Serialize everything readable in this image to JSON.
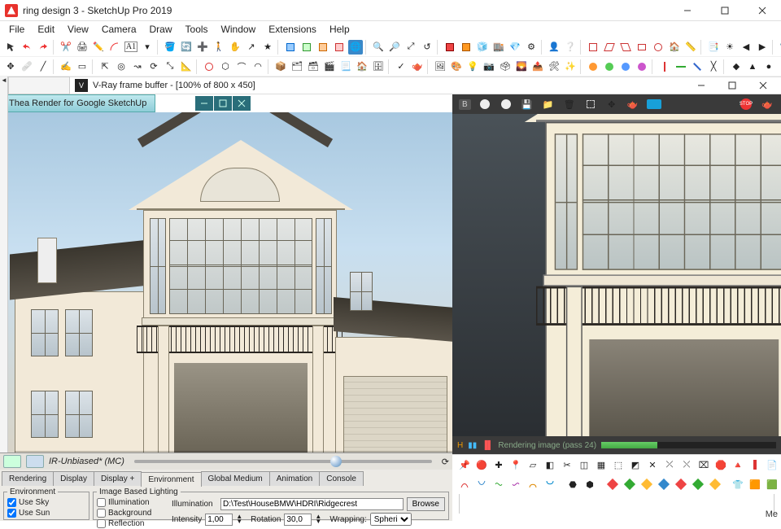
{
  "title": "ring design 3 - SketchUp Pro 2019",
  "menu": [
    "File",
    "Edit",
    "View",
    "Camera",
    "Draw",
    "Tools",
    "Window",
    "Extensions",
    "Help"
  ],
  "vray_title": "V-Ray frame buffer - [100% of 800 x 450]",
  "thea_tab": "Thea Render for Google SketchUp",
  "thea_mode": "IR-Unbiased* (MC)",
  "thea_tabs": [
    "Rendering",
    "Display",
    "Display +",
    "Environment",
    "Global Medium",
    "Animation",
    "Console"
  ],
  "thea_active_tab": "Environment",
  "env": {
    "group": "Environment",
    "use_sky": "Use Sky",
    "use_sun": "Use Sun"
  },
  "ibl": {
    "group": "Image Based Lighting",
    "illumination_cb": "Illumination",
    "background_cb": "Background",
    "reflection_cb": "Reflection",
    "illumination_lbl": "Illumination",
    "path": "D:\\Test\\HouseBMW\\HDRI\\Ridgecrest",
    "browse": "Browse",
    "intensity_lbl": "Intensity",
    "intensity": "1,00",
    "rotation_lbl": "Rotation",
    "rotation": "30,0",
    "wrapping_lbl": "Wrapping:",
    "wrapping": "Spheri"
  },
  "vr": {
    "b_label": "B",
    "status": "Rendering image (pass 24)"
  },
  "status_right": "Me"
}
